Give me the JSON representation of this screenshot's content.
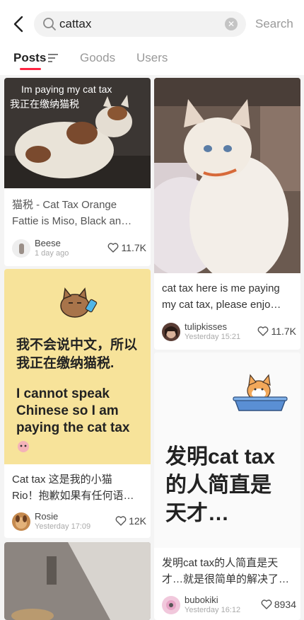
{
  "search": {
    "query": "cattax",
    "button_label": "Search"
  },
  "tabs": [
    {
      "label": "Posts",
      "active": true
    },
    {
      "label": "Goods",
      "active": false
    },
    {
      "label": "Users",
      "active": false
    }
  ],
  "posts": [
    {
      "overlay_en": "Im paying my cat tax",
      "overlay_zh": "我正在缴纳猫税",
      "title_lines": [
        "猫税 - Cat Tax Orange",
        "Fattie is Miso, Black an…"
      ],
      "author": "Beese",
      "time": "1 day ago",
      "likes": "11.7K"
    },
    {
      "title_lines": [
        "cat tax here is me paying",
        "my cat tax, please enjo…"
      ],
      "author": "tulipkisses",
      "time": "Yesterday 15:21",
      "likes": "11.7K"
    },
    {
      "image_text_zh_1": "我不会说中文，所以",
      "image_text_zh_2": "我正在缴纳猫税.",
      "image_text_en_1": "I cannot speak",
      "image_text_en_2": "Chinese so I am",
      "image_text_en_3": "paying the cat tax",
      "title_lines": [
        "Cat tax 这是我的小猫",
        "Rio！抱歉如果有任何语…"
      ],
      "author": "Rosie",
      "time": "Yesterday 17:09",
      "likes": "12K"
    },
    {
      "image_text_1": "发明cat tax",
      "image_text_2": "的人简直是",
      "image_text_3": "天才…",
      "title_lines": [
        "发明cat tax的人简直是天",
        "才…就是很简单的解决了…"
      ],
      "author": "bubokiki",
      "time": "Yesterday 16:12",
      "likes": "8934"
    }
  ],
  "colors": {
    "accent": "#ff2442",
    "yellow_card": "#f7e39a"
  }
}
